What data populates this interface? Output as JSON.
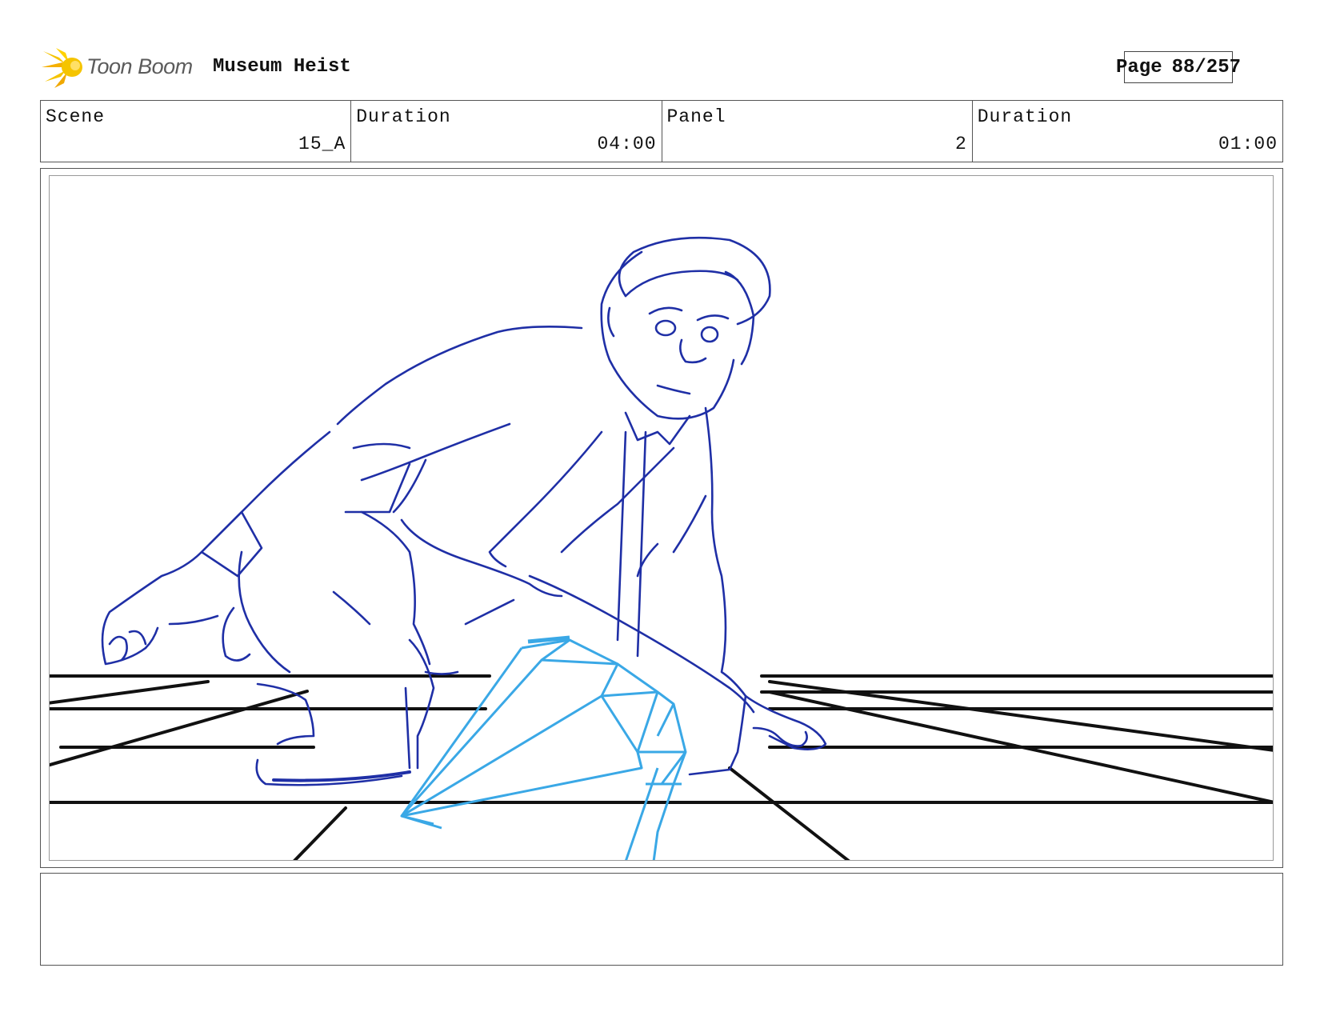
{
  "header": {
    "logo_text": "Toon Boom",
    "project_title": "Museum Heist",
    "page_label": "Page",
    "page_value": "88/257"
  },
  "info": {
    "scene_label": "Scene",
    "scene_value": "15_A",
    "scene_duration_label": "Duration",
    "scene_duration_value": "04:00",
    "panel_label": "Panel",
    "panel_value": "2",
    "panel_duration_label": "Duration",
    "panel_duration_value": "01:00"
  },
  "panel": {
    "sketch_icon": "crouching-thief-with-diamond-sketch"
  },
  "notes": {
    "text": ""
  },
  "colors": {
    "character_line": "#1f2fa6",
    "diamond_line": "#3aa8e6",
    "floor_line": "#111111",
    "logo_yellow": "#f5c400"
  }
}
